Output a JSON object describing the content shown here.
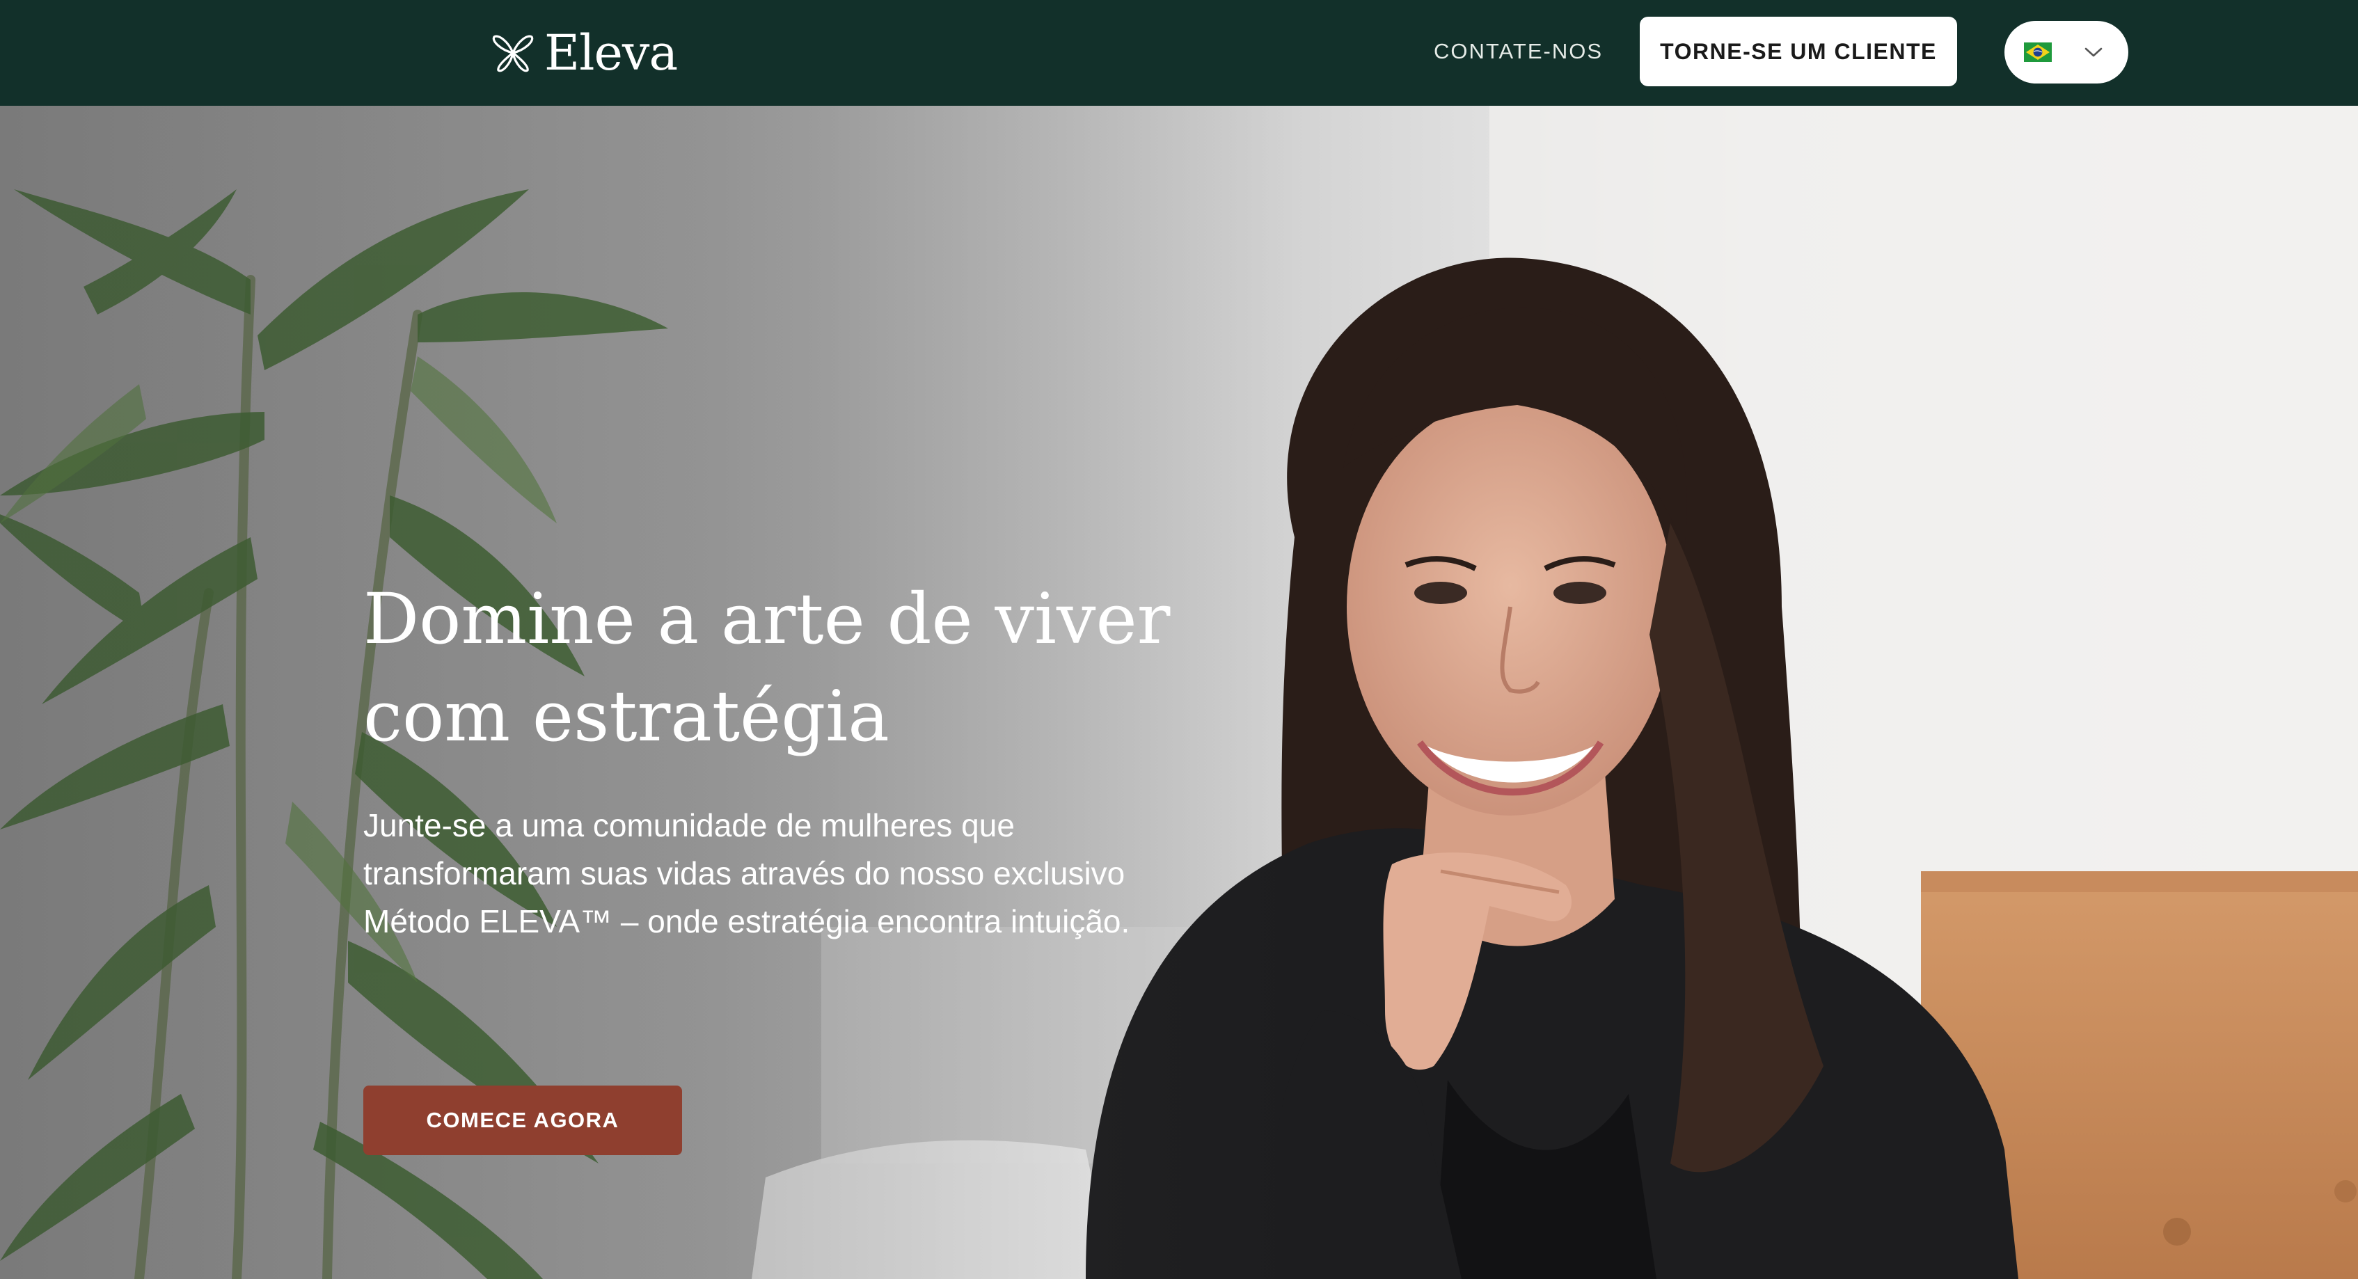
{
  "header": {
    "logo_text": "Eleva",
    "logo_icon": "butterfly-icon",
    "nav_contact_label": "CONTATE-NOS",
    "cta_label": "TORNE-SE UM CLIENTE",
    "language": {
      "flag_icon": "brazil-flag-icon",
      "chevron_icon": "chevron-down-icon"
    }
  },
  "hero": {
    "title_line1": "Domine a arte de viver",
    "title_line2": "com estratégia",
    "subtitle": "Junte-se a uma comunidade de mulheres que transformaram suas vidas através do nosso exclusivo Método ELEVA™ – onde estratégia encontra intuição.",
    "cta_label": "COMECE AGORA",
    "cta_color": "#8f3f2f"
  },
  "colors": {
    "header_bg": "#12302a",
    "white": "#ffffff"
  }
}
